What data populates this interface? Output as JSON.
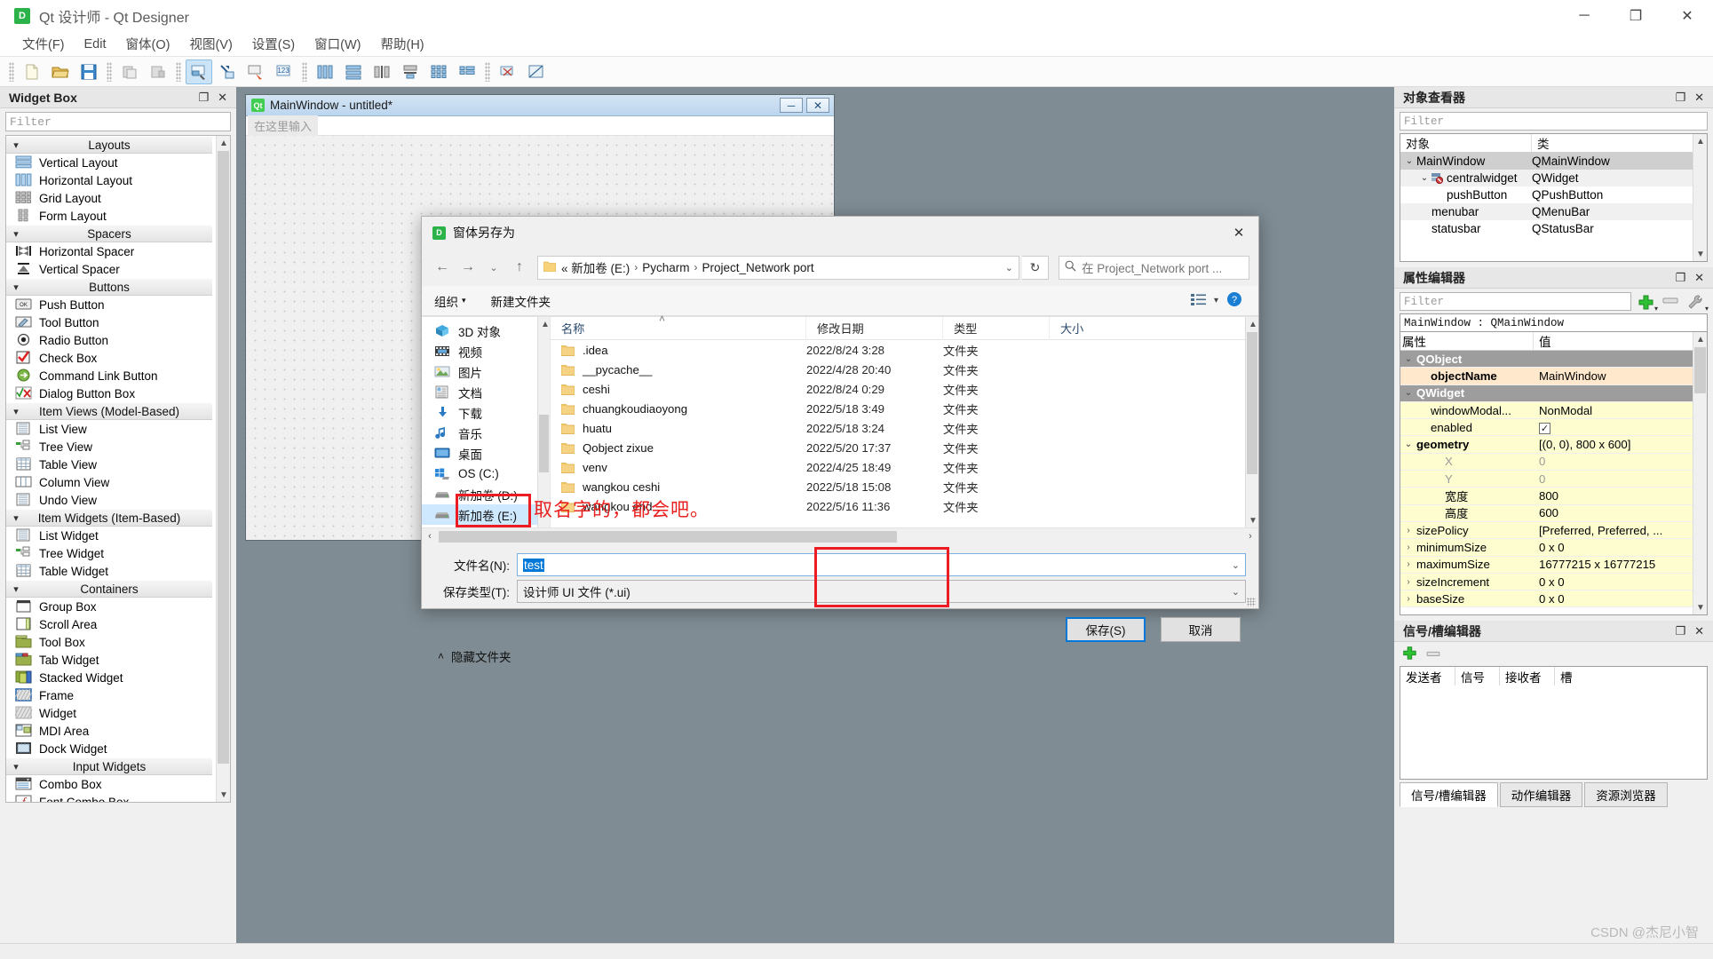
{
  "window": {
    "title": "Qt 设计师 - Qt Designer",
    "app_badge": "D",
    "minimize": "─",
    "maximize": "❐",
    "close": "✕"
  },
  "menubar": {
    "items": [
      {
        "label": "文件(F)"
      },
      {
        "label": "Edit"
      },
      {
        "label": "窗体(O)"
      },
      {
        "label": "视图(V)"
      },
      {
        "label": "设置(S)"
      },
      {
        "label": "窗口(W)"
      },
      {
        "label": "帮助(H)"
      }
    ]
  },
  "toolbar": {
    "groups": [
      [
        "new-file-icon",
        "open-file-icon",
        "save-file-icon"
      ],
      [
        "undo-icon",
        "redo-icon"
      ],
      [
        "edit-widgets-icon",
        "edit-signals-slots-icon",
        "edit-buddies-icon",
        "edit-tab-order-icon"
      ],
      [
        "layout-horizontally-icon",
        "layout-vertically-icon",
        "layout-splitter-horizontal-icon",
        "layout-splitter-vertical-icon",
        "layout-grid-icon",
        "layout-form-icon"
      ],
      [
        "break-layout-icon",
        "adjust-size-icon"
      ]
    ]
  },
  "widget_box": {
    "title": "Widget Box",
    "float_btn": "❐",
    "close_btn": "✕",
    "filter_placeholder": "Filter",
    "groups": [
      {
        "name": "Layouts",
        "items": [
          {
            "label": "Vertical Layout",
            "icon": "vertical-layout-icon"
          },
          {
            "label": "Horizontal Layout",
            "icon": "horizontal-layout-icon"
          },
          {
            "label": "Grid Layout",
            "icon": "grid-layout-icon"
          },
          {
            "label": "Form Layout",
            "icon": "form-layout-icon"
          }
        ]
      },
      {
        "name": "Spacers",
        "items": [
          {
            "label": "Horizontal Spacer",
            "icon": "horizontal-spacer-icon"
          },
          {
            "label": "Vertical Spacer",
            "icon": "vertical-spacer-icon"
          }
        ]
      },
      {
        "name": "Buttons",
        "items": [
          {
            "label": "Push Button",
            "icon": "push-button-icon"
          },
          {
            "label": "Tool Button",
            "icon": "tool-button-icon"
          },
          {
            "label": "Radio Button",
            "icon": "radio-button-icon"
          },
          {
            "label": "Check Box",
            "icon": "check-box-icon"
          },
          {
            "label": "Command Link Button",
            "icon": "command-link-button-icon"
          },
          {
            "label": "Dialog Button Box",
            "icon": "dialog-button-box-icon"
          }
        ]
      },
      {
        "name": "Item Views (Model-Based)",
        "items": [
          {
            "label": "List View",
            "icon": "list-view-icon"
          },
          {
            "label": "Tree View",
            "icon": "tree-view-icon"
          },
          {
            "label": "Table View",
            "icon": "table-view-icon"
          },
          {
            "label": "Column View",
            "icon": "column-view-icon"
          },
          {
            "label": "Undo View",
            "icon": "undo-view-icon"
          }
        ]
      },
      {
        "name": "Item Widgets (Item-Based)",
        "items": [
          {
            "label": "List Widget",
            "icon": "list-widget-icon"
          },
          {
            "label": "Tree Widget",
            "icon": "tree-widget-icon"
          },
          {
            "label": "Table Widget",
            "icon": "table-widget-icon"
          }
        ]
      },
      {
        "name": "Containers",
        "items": [
          {
            "label": "Group Box",
            "icon": "group-box-icon"
          },
          {
            "label": "Scroll Area",
            "icon": "scroll-area-icon"
          },
          {
            "label": "Tool Box",
            "icon": "tool-box-icon"
          },
          {
            "label": "Tab Widget",
            "icon": "tab-widget-icon"
          },
          {
            "label": "Stacked Widget",
            "icon": "stacked-widget-icon"
          },
          {
            "label": "Frame",
            "icon": "frame-icon"
          },
          {
            "label": "Widget",
            "icon": "widget-icon"
          },
          {
            "label": "MDI Area",
            "icon": "mdi-area-icon"
          },
          {
            "label": "Dock Widget",
            "icon": "dock-widget-icon"
          }
        ]
      },
      {
        "name": "Input Widgets",
        "items": [
          {
            "label": "Combo Box",
            "icon": "combo-box-icon"
          },
          {
            "label": "Font Combo Box",
            "icon": "font-combo-box-icon"
          }
        ]
      }
    ]
  },
  "canvas": {
    "form_title": "MainWindow - untitled*",
    "form_badge": "Qt",
    "minimize": "─",
    "close": "✕",
    "menubar_placeholder": "在这里输入"
  },
  "object_inspector": {
    "title": "对象查看器",
    "float_btn": "❐",
    "close_btn": "✕",
    "filter_placeholder": "Filter",
    "columns": [
      "对象",
      "类"
    ],
    "rows": [
      {
        "object": "MainWindow",
        "class": "QMainWindow",
        "depth": 0,
        "twisty": "⌄",
        "selected": true
      },
      {
        "object": "centralwidget",
        "class": "QWidget",
        "depth": 1,
        "twisty": "⌄",
        "selected": false
      },
      {
        "object": "pushButton",
        "class": "QPushButton",
        "depth": 2,
        "twisty": "",
        "selected": false
      },
      {
        "object": "menubar",
        "class": "QMenuBar",
        "depth": 1,
        "twisty": "",
        "selected": false
      },
      {
        "object": "statusbar",
        "class": "QStatusBar",
        "depth": 1,
        "twisty": "",
        "selected": false
      }
    ]
  },
  "property_editor": {
    "title": "属性编辑器",
    "float_btn": "❐",
    "close_btn": "✕",
    "filter_placeholder": "Filter",
    "add_icon": "plus-icon",
    "remove_icon": "minus-icon",
    "config_icon": "wrench-icon",
    "object_header": "MainWindow : QMainWindow",
    "columns": [
      "属性",
      "值"
    ],
    "rows": [
      {
        "kind": "group",
        "name": "QObject",
        "value": "",
        "twisty": "⌄"
      },
      {
        "kind": "highlight",
        "name": "objectName",
        "value": "MainWindow",
        "twisty": "",
        "indent": 1,
        "bold": true
      },
      {
        "kind": "group",
        "name": "QWidget",
        "value": "",
        "twisty": "⌄"
      },
      {
        "kind": "yellow",
        "name": "windowModal...",
        "value": "NonModal",
        "twisty": "",
        "indent": 1
      },
      {
        "kind": "yellow",
        "name": "enabled",
        "value": "CHECKBOX",
        "twisty": "",
        "indent": 1
      },
      {
        "kind": "yellow",
        "name": "geometry",
        "value": "[(0, 0), 800 x 600]",
        "twisty": "⌄",
        "bold": true
      },
      {
        "kind": "yellow",
        "name": "X",
        "value": "0",
        "twisty": "",
        "indent": 2,
        "dim": true
      },
      {
        "kind": "yellow",
        "name": "Y",
        "value": "0",
        "twisty": "",
        "indent": 2,
        "dim": true
      },
      {
        "kind": "yellow",
        "name": "宽度",
        "value": "800",
        "twisty": "",
        "indent": 2
      },
      {
        "kind": "yellow",
        "name": "高度",
        "value": "600",
        "twisty": "",
        "indent": 2
      },
      {
        "kind": "yellow",
        "name": "sizePolicy",
        "value": "[Preferred, Preferred, ...",
        "twisty": "›"
      },
      {
        "kind": "yellow",
        "name": "minimumSize",
        "value": "0 x 0",
        "twisty": "›"
      },
      {
        "kind": "yellow",
        "name": "maximumSize",
        "value": "16777215 x 16777215",
        "twisty": "›"
      },
      {
        "kind": "yellow",
        "name": "sizeIncrement",
        "value": "0 x 0",
        "twisty": "›"
      },
      {
        "kind": "yellow",
        "name": "baseSize",
        "value": "0 x 0",
        "twisty": "›"
      }
    ]
  },
  "signal_slot_editor": {
    "title": "信号/槽编辑器",
    "float_btn": "❐",
    "close_btn": "✕",
    "add_icon": "plus-icon",
    "remove_icon": "minus-icon",
    "columns": [
      "发送者",
      "信号",
      "接收者",
      "槽"
    ],
    "tabs": [
      {
        "label": "信号/槽编辑器",
        "active": true
      },
      {
        "label": "动作编辑器",
        "active": false
      },
      {
        "label": "资源浏览器",
        "active": false
      }
    ]
  },
  "save_dialog": {
    "title": "窗体另存为",
    "badge": "D",
    "close": "✕",
    "nav": {
      "back": "←",
      "forward": "→",
      "history": "⌄",
      "up": "↑"
    },
    "breadcrumb": [
      "« 新加卷 (E:)",
      "Pycharm",
      "Project_Network port"
    ],
    "breadcrumb_caret": "⌄",
    "refresh_icon": "refresh-icon",
    "search_placeholder": "在 Project_Network port ...",
    "search_icon": "search-icon",
    "commands": [
      {
        "label": "组织",
        "caret": "▾",
        "name": "organize-menu"
      },
      {
        "label": "新建文件夹",
        "caret": "",
        "name": "new-folder-button"
      }
    ],
    "view_icon": "view-options-icon",
    "view_caret": "▾",
    "help_icon": "help-icon",
    "sidebar": [
      {
        "label": "3D 对象",
        "icon": "3d-objects-icon",
        "selected": false
      },
      {
        "label": "视频",
        "icon": "videos-icon",
        "selected": false
      },
      {
        "label": "图片",
        "icon": "pictures-icon",
        "selected": false
      },
      {
        "label": "文档",
        "icon": "documents-icon",
        "selected": false
      },
      {
        "label": "下载",
        "icon": "downloads-icon",
        "selected": false
      },
      {
        "label": "音乐",
        "icon": "music-icon",
        "selected": false
      },
      {
        "label": "桌面",
        "icon": "desktop-icon",
        "selected": false
      },
      {
        "label": "OS (C:)",
        "icon": "windows-drive-icon",
        "selected": false
      },
      {
        "label": "新加卷 (D:)",
        "icon": "drive-icon",
        "selected": false
      },
      {
        "label": "新加卷 (E:)",
        "icon": "drive-icon",
        "selected": true
      }
    ],
    "file_columns": [
      "名称",
      "修改日期",
      "类型",
      "大小"
    ],
    "sort_indicator": "˄",
    "files": [
      {
        "name": ".idea",
        "date": "2022/8/24 3:28",
        "type": "文件夹",
        "size": ""
      },
      {
        "name": "__pycache__",
        "date": "2022/4/28 20:40",
        "type": "文件夹",
        "size": ""
      },
      {
        "name": "ceshi",
        "date": "2022/8/24 0:29",
        "type": "文件夹",
        "size": ""
      },
      {
        "name": "chuangkoudiaoyong",
        "date": "2022/5/18 3:49",
        "type": "文件夹",
        "size": ""
      },
      {
        "name": "huatu",
        "date": "2022/5/18 3:24",
        "type": "文件夹",
        "size": ""
      },
      {
        "name": "Qobject zixue",
        "date": "2022/5/20 17:37",
        "type": "文件夹",
        "size": ""
      },
      {
        "name": "venv",
        "date": "2022/4/25 18:49",
        "type": "文件夹",
        "size": ""
      },
      {
        "name": "wangkou  ceshi",
        "date": "2022/5/18 15:08",
        "type": "文件夹",
        "size": ""
      },
      {
        "name": "wangkou end",
        "date": "2022/5/16 11:36",
        "type": "文件夹",
        "size": ""
      }
    ],
    "filename_label": "文件名(N):",
    "filename_value": "test",
    "filetype_label": "保存类型(T):",
    "filetype_value": "设计师 UI 文件 (*.ui)",
    "combo_caret": "⌄",
    "annotation": "取名字的，都会吧。",
    "save_button": "保存(S)",
    "cancel_button": "取消",
    "hide_folders": "隐藏文件夹",
    "hide_folders_caret": "˄"
  },
  "watermark": "CSDN @杰尼小智",
  "colors": {
    "accent": "#0078d7",
    "annotation_red": "#ed1c24",
    "qt_green": "#41cd52",
    "selection_blue": "#cde8ff"
  }
}
